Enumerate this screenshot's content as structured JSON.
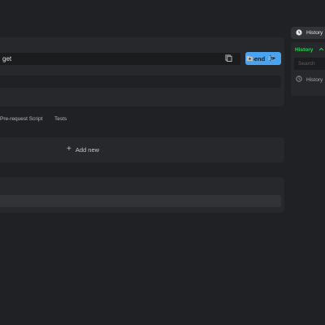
{
  "request": {
    "url_value": "get",
    "send_label": "Send"
  },
  "tabs": [
    {
      "label": "Pre-request Script"
    },
    {
      "label": "Tests"
    }
  ],
  "body": {
    "add_new_label": "Add new"
  },
  "sidebar": {
    "toggle_label": "History",
    "section_label": "History",
    "search_placeholder": "Search",
    "item_label": "History"
  },
  "colors": {
    "accent": "#4aa3ee",
    "section_active": "#35d05a"
  },
  "icons": [
    "send-icon",
    "copy-icon",
    "folder-add-icon",
    "wrap-lines-icon",
    "clock-icon",
    "chevron-up-icon",
    "plus-icon"
  ]
}
